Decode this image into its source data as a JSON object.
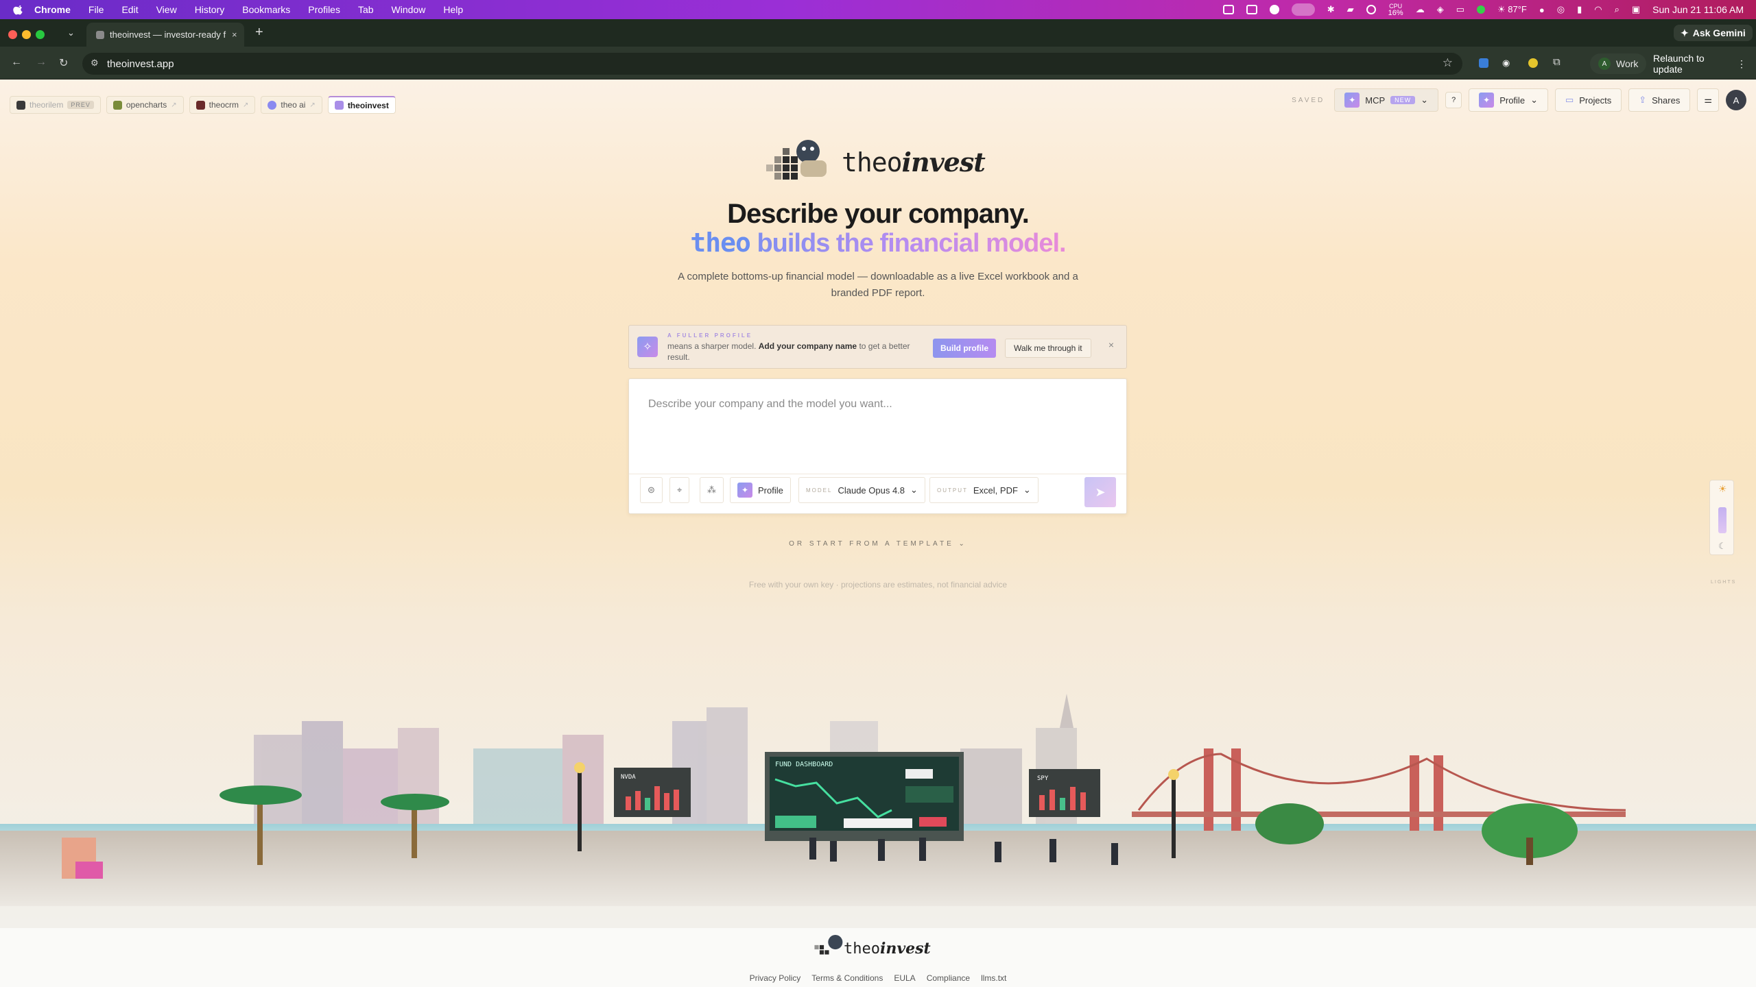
{
  "menubar": {
    "app": "Chrome",
    "items": [
      "File",
      "Edit",
      "View",
      "History",
      "Bookmarks",
      "Profiles",
      "Tab",
      "Window",
      "Help"
    ],
    "cpu_label": "CPU",
    "cpu_value": "16%",
    "weather": "87°F",
    "datetime": "Sun Jun 21  11:06 AM"
  },
  "browser": {
    "tab_title": "theoinvest — investor-ready f",
    "url": "theoinvest.app",
    "profile_label": "Work",
    "profile_initial": "A",
    "relaunch": "Relaunch to update",
    "ask_gemini": "Ask Gemini",
    "colors": {
      "close": "#ff5f57",
      "minimize": "#febc2e",
      "maximize": "#28c840"
    }
  },
  "app_tabs": [
    {
      "label": "theorilem",
      "badge": "PREV",
      "favicon": "#3a3a3a"
    },
    {
      "label": "opencharts",
      "favicon": "#7a8c3a"
    },
    {
      "label": "theocrm",
      "favicon": "#6a2a2a"
    },
    {
      "label": "theo ai",
      "favicon": "#8a8af0"
    },
    {
      "label": "theoinvest",
      "favicon": "#a98ee8",
      "active": true
    }
  ],
  "toolbar": {
    "saved": "SAVED",
    "mcp": "MCP",
    "mcp_badge": "NEW",
    "help": "?",
    "profile": "Profile",
    "projects": "Projects",
    "shares": "Shares",
    "avatar": "A"
  },
  "hero": {
    "brand_plain": "theo",
    "brand_italic": "invest",
    "headline": "Describe your company.",
    "subheadline_theo": "theo",
    "subheadline_rest": " builds the financial model.",
    "description": "A complete bottoms-up financial model — downloadable as a live Excel workbook and a branded PDF report."
  },
  "banner": {
    "eyebrow": "A FULLER PROFILE",
    "text_pre": "means a sharper model. ",
    "text_bold": "Add your company name",
    "text_post": " to get a better result.",
    "build_button": "Build profile",
    "walk_button": "Walk me through it",
    "close": "×"
  },
  "composer": {
    "placeholder": "Describe your company and the model you want...",
    "profile_button": "Profile",
    "model_label": "MODEL",
    "model_value": "Claude Opus 4.8",
    "output_label": "OUTPUT",
    "output_value": "Excel, PDF"
  },
  "template_link": "OR START FROM A TEMPLATE",
  "fineprint": "Free with your own key · projections are estimates, not financial advice",
  "theme_rail_label": "LIGHTS",
  "scene": {
    "screen_title": "FUND DASHBOARD",
    "left_board": "NVDA",
    "right_board": "SPY"
  },
  "footer": {
    "brand_plain": "theo",
    "brand_italic": "invest",
    "links": [
      "Privacy Policy",
      "Terms & Conditions",
      "EULA",
      "Compliance",
      "llms.txt"
    ]
  }
}
